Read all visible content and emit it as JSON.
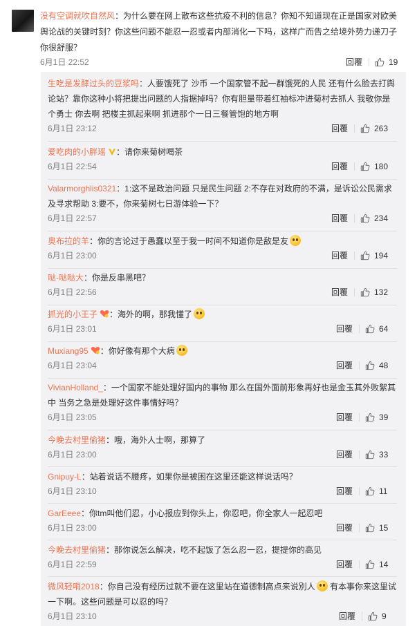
{
  "main_comment": {
    "username": "没有空调就吹自然风",
    "text": "：为什么要在网上散布这些抗疫不利的信息？你知不知道现在正是国家对欧美舆论战的关键时刻？你这些问题不能忍一忍或者内部消化一下吗，这样广而告之给境外势力递刀子你很舒服？",
    "time": "6月1日 22:52",
    "reply_label": "回覆",
    "likes": "19"
  },
  "replies": [
    {
      "username": "生吃是发酵过头的豆浆吗",
      "badge": "",
      "text": "：人要饿死了 沙币 一个国家管不起一群饿死的人民 还有什么脸去打舆论站？靠你这种小将把提出问题的人指据掉吗？你有胆量带着红袖标冲进菊村去抓人 我敬你是个勇士 你去啊 把楼主抓起来啊 抓进那个一日三餐管饱的地方啊",
      "emoji": false,
      "time": "6月1日 23:12",
      "reply_label": "回覆",
      "likes": "263"
    },
    {
      "username": "爱吃肉的小胖瑶",
      "badge": "v",
      "text": "：请你来菊树喝茶",
      "emoji": false,
      "time": "6月1日 22:54",
      "reply_label": "回覆",
      "likes": "180"
    },
    {
      "username": "Valarmorghlis0321",
      "badge": "",
      "text": "：1:这不是政治问题 只是民生问题 2:不存在对政府的不满，是诉讼公民需求及寻求帮助 3:要不，你来菊树七日游体验一下？",
      "emoji": false,
      "time": "6月1日 22:57",
      "reply_label": "回覆",
      "likes": "234"
    },
    {
      "username": "奥布拉的羊",
      "badge": "",
      "text": "：你的言论过于愚蠢以至于我一时间不知道你是敌是友",
      "emoji": true,
      "time": "6月1日 23:00",
      "reply_label": "回覆",
      "likes": "194"
    },
    {
      "username": "哒-哒哒大",
      "badge": "",
      "text": "：你是反串黑吧？",
      "emoji": false,
      "time": "6月1日 22:56",
      "reply_label": "回覆",
      "likes": "132"
    },
    {
      "username": "抓光的小王子",
      "badge": "heart",
      "text": "：海外的啊，那我懂了",
      "emoji": true,
      "time": "6月1日 23:01",
      "reply_label": "回覆",
      "likes": "64"
    },
    {
      "username": "Muxiang95",
      "badge": "heart",
      "text": "：你好像有那个大病",
      "emoji": true,
      "time": "6月1日 23:04",
      "reply_label": "回覆",
      "likes": "48"
    },
    {
      "username": "VivianHolland_",
      "badge": "",
      "text": "：一个国家不能处理好国内的事物 那么在国外面前形象再好也是金玉其外败絮其中 当务之急是处理好这件事情好吗？",
      "emoji": false,
      "time": "6月1日 23:05",
      "reply_label": "回覆",
      "likes": "39"
    },
    {
      "username": "今晚去村里偷猪",
      "badge": "",
      "text": "：哦，海外人士啊，那算了",
      "emoji": false,
      "time": "6月1日 23:00",
      "reply_label": "回覆",
      "likes": "33"
    },
    {
      "username": "Gnipuy-L",
      "badge": "",
      "text": "：站着说话不腰疼，如果你是被困在这里还能这样说话吗？",
      "emoji": false,
      "time": "6月1日 23:10",
      "reply_label": "回覆",
      "likes": "11"
    },
    {
      "username": "GarEeee",
      "badge": "",
      "text": "：你tm叫他们忍，小心报应到你头上，你忍吧，你全家人一起忍吧",
      "emoji": false,
      "time": "6月1日 23:00",
      "reply_label": "回覆",
      "likes": "15"
    },
    {
      "username": "今晚去村里偷猪",
      "badge": "",
      "text": "：那你说怎么解决，吃不起饭了怎么忍一忍，提提你的高见",
      "emoji": false,
      "time": "6月1日 22:59",
      "reply_label": "回覆",
      "likes": "14"
    },
    {
      "username": "微风轻哨2018",
      "badge": "",
      "text": "：你自己没有经历过就不要在这里站在道德制高点来说別人",
      "emoji": true,
      "text2": " 有本事你来这里试一下啊。这些问题是可以忍的吗？",
      "time": "6月1日 23:10",
      "reply_label": "回覆",
      "likes": "9"
    }
  ],
  "colors": {
    "username": "#eb7350",
    "text": "#333333",
    "meta": "#808080",
    "panel": "#f2f2f5"
  },
  "icons": {
    "like": "thumbs-up-icon",
    "verified": "v-badge-icon",
    "heart": "heart-badge-icon"
  }
}
